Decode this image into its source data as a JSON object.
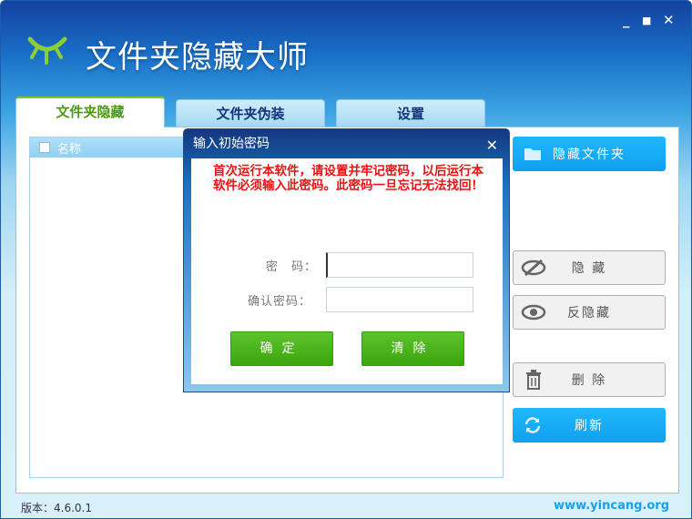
{
  "app": {
    "title": "文件夹隐藏大师",
    "version": "版本：4.6.0.1",
    "url": "www.yincang.org"
  },
  "window_controls": {
    "minimize": "_",
    "maximize": "■",
    "close": "✕"
  },
  "tabs": [
    {
      "label": "文件夹隐藏",
      "active": true
    },
    {
      "label": "文件夹伪装"
    },
    {
      "label": "设置"
    }
  ],
  "list": {
    "column": "名称"
  },
  "side_buttons": {
    "hide_folder": "隐藏文件夹",
    "hide": "隐 藏",
    "unhide": "反隐藏",
    "delete": "删 除",
    "refresh": "刷新"
  },
  "dialog": {
    "title": "输入初始密码",
    "close": "✕",
    "message": "首次运行本软件，请设置并牢记密码，以后运行本软件必须输入此密码。此密码一旦忘记无法找回！",
    "password_label": "密　码：",
    "confirm_label": "确认密码：",
    "password_value": "",
    "confirm_value": "",
    "ok": "确定",
    "clear": "清除"
  }
}
